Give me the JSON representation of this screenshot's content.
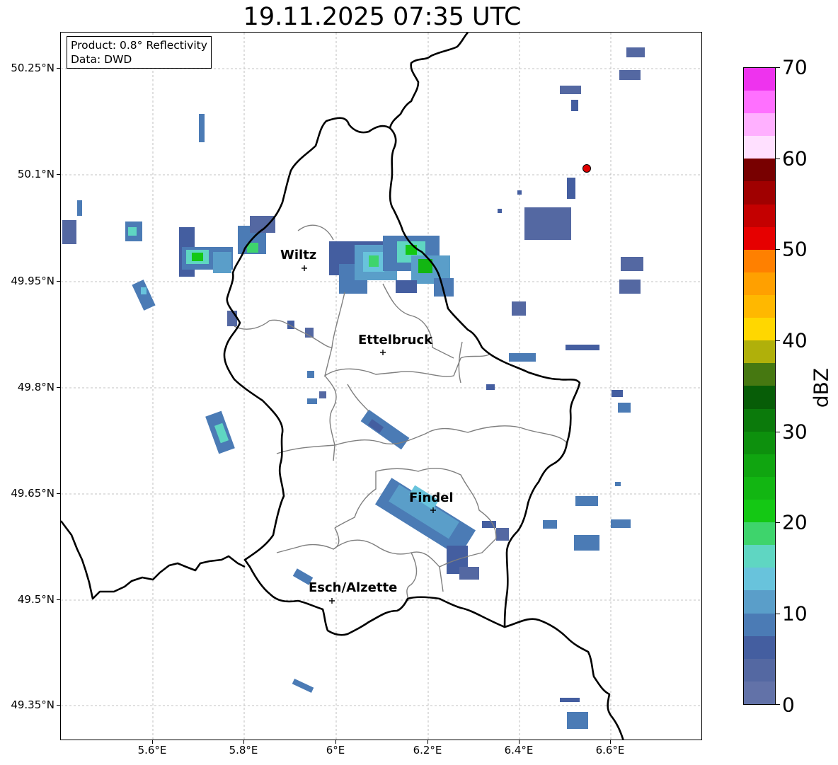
{
  "title": "19.11.2025 07:35 UTC",
  "info_box": {
    "product": "Product: 0.8° Reflectivity",
    "data": "Data: DWD"
  },
  "axes": {
    "y_ticks": [
      "50.25°N",
      "50.1°N",
      "49.95°N",
      "49.8°N",
      "49.65°N",
      "49.5°N",
      "49.35°N"
    ],
    "x_ticks": [
      "5.6°E",
      "5.8°E",
      "6°E",
      "6.2°E",
      "6.4°E",
      "6.6°E"
    ]
  },
  "cities": [
    {
      "name": "Wiltz"
    },
    {
      "name": "Ettelbruck"
    },
    {
      "name": "Findel"
    },
    {
      "name": "Esch/Alzette"
    }
  ],
  "colorbar": {
    "label": "dBZ",
    "ticks": [
      "0",
      "10",
      "20",
      "30",
      "40",
      "50",
      "60",
      "70"
    ],
    "colors": [
      "#6272a8",
      "#5468a2",
      "#445ea0",
      "#4b7bb5",
      "#5a9ec9",
      "#68c3dc",
      "#5fd6c2",
      "#3ed46c",
      "#14c814",
      "#12b612",
      "#10a510",
      "#0d900d",
      "#0b7a0b",
      "#075d07",
      "#467811",
      "#b0b00a",
      "#ffd700",
      "#ffb800",
      "#ffa000",
      "#ff8000",
      "#e60000",
      "#c40000",
      "#a00000",
      "#780000",
      "#ffe0ff",
      "#ffb0ff",
      "#ff70ff",
      "#ee33ee"
    ]
  },
  "colors": {
    "border_national": "#000000",
    "border_cantonal": "#7f7f7f",
    "radar_marker": "#e00000",
    "gridline": "#b0b0b0"
  }
}
